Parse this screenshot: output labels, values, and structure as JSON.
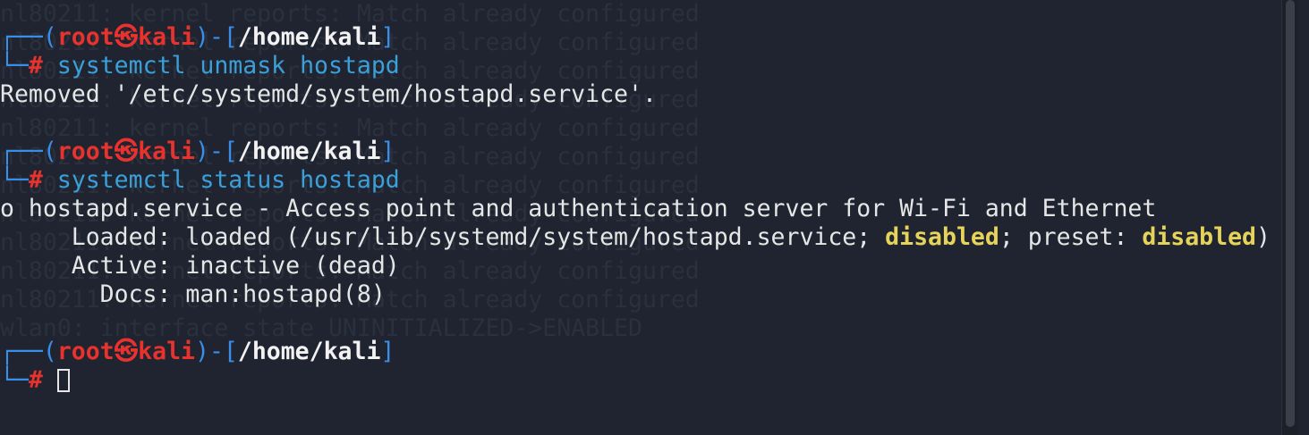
{
  "prompt": {
    "corner_top": "┌──(",
    "user": "root",
    "at_symbol": "㉿",
    "host": "kali",
    "path_open": ")-[",
    "path": "/home/kali",
    "path_close": "]",
    "corner_bottom": "└─",
    "hash": "#"
  },
  "commands": [
    "systemctl unmask hostapd",
    "systemctl status hostapd"
  ],
  "output": {
    "removed": "Removed '/etc/systemd/system/hostapd.service'.",
    "service_line": "o hostapd.service - Access point and authentication server for Wi-Fi and Ethernet",
    "loaded_prefix": "     Loaded: loaded (/usr/lib/systemd/system/hostapd.service; ",
    "loaded_state": "disabled",
    "loaded_mid": "; preset: ",
    "preset_state": "disabled",
    "loaded_suffix": ")",
    "active": "     Active: inactive (dead)",
    "docs": "       Docs: man:hostapd(8)"
  },
  "background_log": [
    "nl80211: kernel reports: Match already configured",
    "nl80211: kernel reports: Match already configured",
    "nl80211: kernel reports: Match already configured",
    "nl80211: kernel reports: Match already configured",
    "nl80211: kernel reports: Match already configured",
    "nl80211: kernel reports: Match already configured",
    "nl80211: kernel reports: Match already configured",
    "nl80211: kernel reports: Match already configured",
    "nl80211: kernel reports: Match already configured",
    "nl80211: kernel reports: Match already configured",
    "nl80211: kernel reports: Match already configured",
    "wlan0: interface state UNINITIALIZED->ENABLED"
  ],
  "colors": {
    "background": "#1f2430",
    "prompt_blue": "#3b8ee8",
    "prompt_red": "#e8322d",
    "command_blue": "#3b9fd8",
    "highlight_yellow": "#e6d35a"
  }
}
